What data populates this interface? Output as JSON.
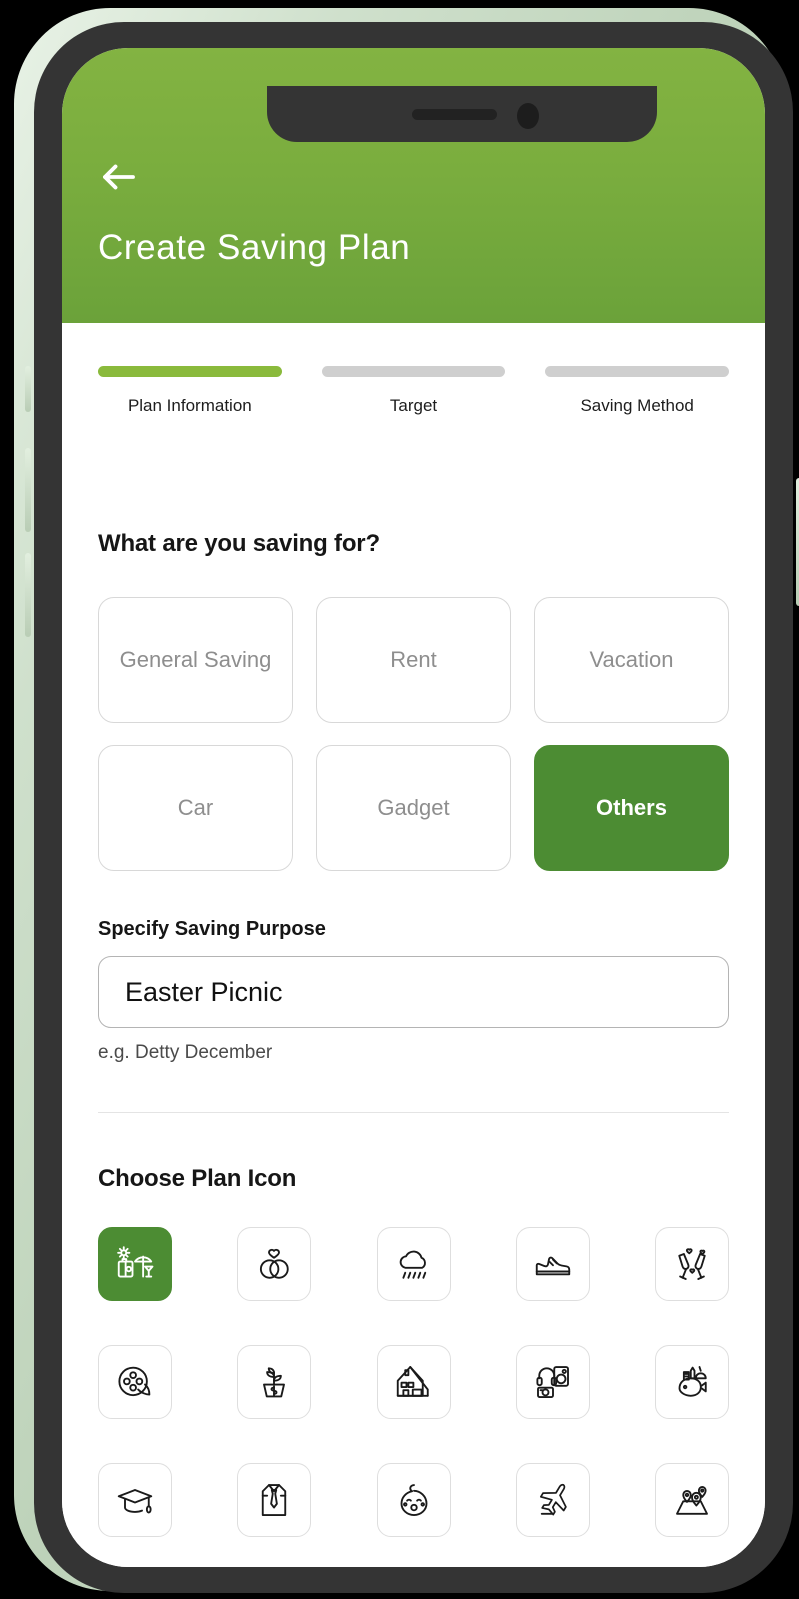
{
  "device": {
    "notch_speaker": "speaker-grille",
    "notch_camera": "front-camera",
    "buttons": [
      "silent-switch",
      "volume-up",
      "volume-down",
      "power"
    ]
  },
  "header": {
    "back_icon": "arrow-left-icon",
    "title": "Create Saving Plan",
    "bg_start": "#83b342",
    "bg_end": "#6ba23a"
  },
  "stepper": {
    "active_color": "#8aba3c",
    "inactive_color": "#cfcfcf",
    "steps": [
      {
        "label": "Plan Information",
        "active": true
      },
      {
        "label": "Target",
        "active": false
      },
      {
        "label": "Saving Method",
        "active": false
      }
    ]
  },
  "purpose_section": {
    "heading": "What are you saving for?",
    "selected_color": "#4c8c33",
    "categories": [
      {
        "label": "General Saving",
        "selected": false
      },
      {
        "label": "Rent",
        "selected": false
      },
      {
        "label": "Vacation",
        "selected": false
      },
      {
        "label": "Car",
        "selected": false
      },
      {
        "label": "Gadget",
        "selected": false
      },
      {
        "label": "Others",
        "selected": true
      }
    ],
    "field_label": "Specify Saving Purpose",
    "field_value": "Easter Picnic",
    "field_placeholder": "Easter Picnic",
    "field_hint": "e.g. Detty December"
  },
  "icon_section": {
    "heading": "Choose Plan Icon",
    "selected_color": "#4c8c33",
    "icons": [
      {
        "name": "vacation-beach-icon",
        "selected": true
      },
      {
        "name": "wedding-rings-icon",
        "selected": false
      },
      {
        "name": "rain-cloud-icon",
        "selected": false
      },
      {
        "name": "sneaker-shoe-icon",
        "selected": false
      },
      {
        "name": "champagne-glasses-icon",
        "selected": false
      },
      {
        "name": "film-reel-icon",
        "selected": false
      },
      {
        "name": "money-plant-icon",
        "selected": false
      },
      {
        "name": "house-home-icon",
        "selected": false
      },
      {
        "name": "electronics-gadget-icon",
        "selected": false
      },
      {
        "name": "groceries-food-icon",
        "selected": false
      },
      {
        "name": "graduation-cap-icon",
        "selected": false
      },
      {
        "name": "shirt-tie-icon",
        "selected": false
      },
      {
        "name": "baby-face-icon",
        "selected": false
      },
      {
        "name": "airplane-travel-icon",
        "selected": false
      },
      {
        "name": "map-pins-icon",
        "selected": false
      }
    ]
  }
}
